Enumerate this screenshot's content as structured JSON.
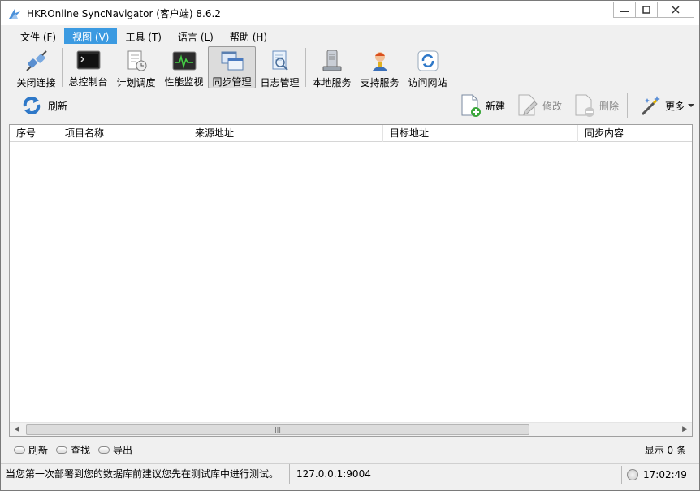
{
  "window": {
    "title": "HKROnline SyncNavigator (客户端) 8.6.2"
  },
  "menu": [
    {
      "label": "文件 (F)",
      "active": false
    },
    {
      "label": "视图 (V)",
      "active": true
    },
    {
      "label": "工具 (T)",
      "active": false
    },
    {
      "label": "语言 (L)",
      "active": false
    },
    {
      "label": "帮助 (H)",
      "active": false
    }
  ],
  "toolbar": {
    "disconnect": "关闭连接",
    "console": "总控制台",
    "schedule": "计划调度",
    "monitor": "性能监视",
    "sync": "同步管理",
    "log": "日志管理",
    "local_service": "本地服务",
    "support": "支持服务",
    "website": "访问网站"
  },
  "subtoolbar": {
    "refresh": "刷新",
    "new": "新建",
    "edit": "修改",
    "delete": "删除",
    "more": "更多"
  },
  "table": {
    "columns": [
      "序号",
      "项目名称",
      "来源地址",
      "目标地址",
      "同步内容"
    ],
    "rows": []
  },
  "bottombar": {
    "refresh": "刷新",
    "find": "查找",
    "export": "导出",
    "count": "显示 0 条"
  },
  "status": {
    "message": "当您第一次部署到您的数据库前建议您先在测试库中进行测试。",
    "server": "127.0.0.1:9004",
    "time": "17:02:49"
  },
  "colors": {
    "menu_active": "#3b9ae1",
    "accent_green": "#3aa63a",
    "icon_blue": "#2e78c8"
  }
}
